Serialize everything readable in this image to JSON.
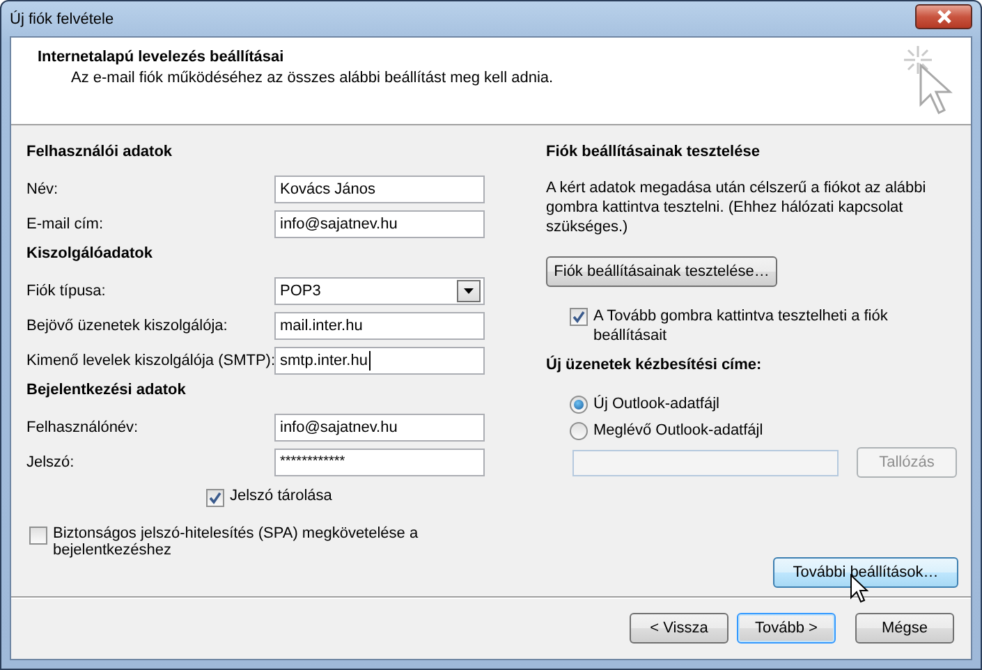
{
  "window": {
    "title": "Új fiók felvétele"
  },
  "header": {
    "title": "Internetalapú levelezés beállításai",
    "subtitle": "Az e-mail fiók működéséhez az összes alábbi beállítást meg kell adnia."
  },
  "left_sections": [
    {
      "heading": "Felhasználói adatok",
      "fields": [
        {
          "kind": "text",
          "label": "Név:",
          "value": "Kovács János"
        },
        {
          "kind": "text",
          "label": "E-mail cím:",
          "value": "info@sajatnev.hu"
        }
      ]
    },
    {
      "heading": "Kiszolgálóadatok",
      "fields": [
        {
          "kind": "select",
          "label": "Fiók típusa:",
          "value": "POP3"
        },
        {
          "kind": "text",
          "label": "Bejövő üzenetek kiszolgálója:",
          "value": "mail.inter.hu"
        },
        {
          "kind": "text",
          "label": "Kimenő levelek kiszolgálója (SMTP):",
          "value": "smtp.inter.hu",
          "focused": true
        }
      ]
    },
    {
      "heading": "Bejelentkezési adatok",
      "fields": [
        {
          "kind": "text",
          "label": "Felhasználónév:",
          "value": "info@sajatnev.hu"
        },
        {
          "kind": "password",
          "label": "Jelszó:",
          "value": "************"
        }
      ]
    }
  ],
  "remember_password": {
    "label": "Jelszó tárolása",
    "checked": true
  },
  "spa": {
    "label": "Biztonságos jelszó-hitelesítés (SPA) megkövetelése a bejelentkezéshez",
    "checked": false
  },
  "test": {
    "heading": "Fiók beállításainak tesztelése",
    "description": "A kért adatok megadása után célszerű a fiókot az alábbi gombra kattintva tesztelni. (Ehhez hálózati kapcsolat szükséges.)",
    "button": "Fiók beállításainak tesztelése…",
    "auto_test": {
      "label": "A Tovább gombra kattintva tesztelheti a fiók beállításait",
      "checked": true
    }
  },
  "delivery": {
    "heading": "Új üzenetek kézbesítési címe:",
    "options": [
      {
        "label": "Új Outlook-adatfájl",
        "selected": true
      },
      {
        "label": "Meglévő Outlook-adatfájl",
        "selected": false
      }
    ],
    "browse": {
      "label": "Tallózás",
      "disabled": true
    }
  },
  "more_settings": {
    "label": "További beállítások…",
    "hovered": true
  },
  "buttons": [
    {
      "label": "< Vissza",
      "default": false
    },
    {
      "label": "Tovább >",
      "default": true
    },
    {
      "label": "Mégse",
      "default": false
    }
  ]
}
